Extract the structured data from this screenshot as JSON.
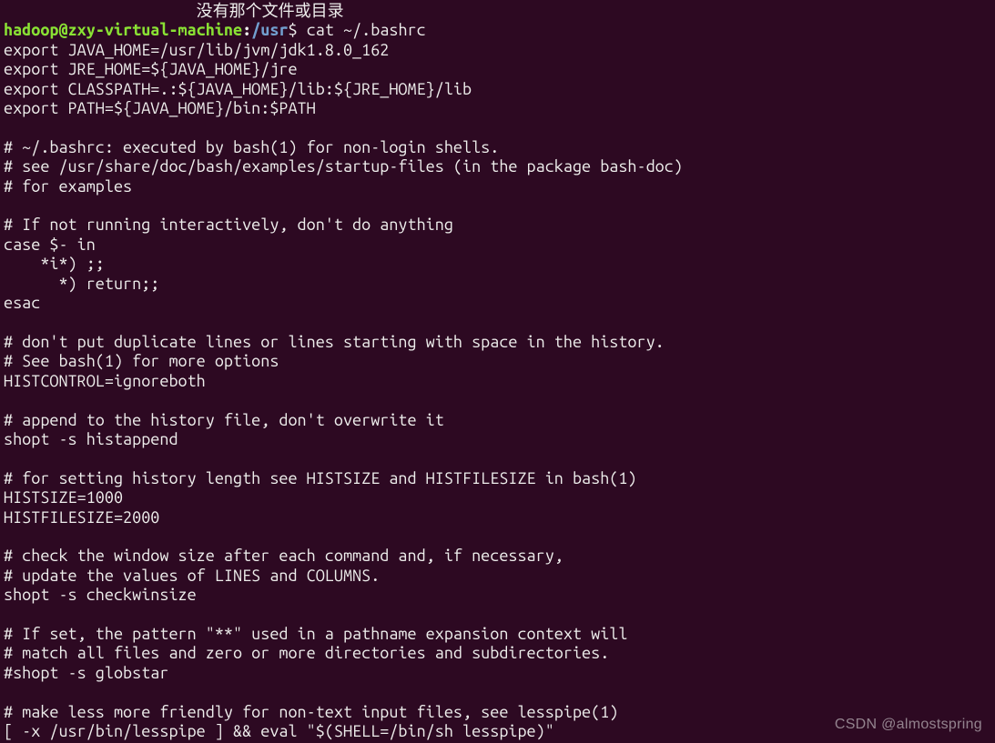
{
  "top_fragment": "                     没有那个文件或目录",
  "prompt": {
    "user": "hadoop",
    "at": "@",
    "host": "zxy-virtual-machine",
    "colon": ":",
    "path": "/usr",
    "dollar": "$ ",
    "command": "cat ~/.bashrc"
  },
  "lines": [
    "export JAVA_HOME=/usr/lib/jvm/jdk1.8.0_162",
    "export JRE_HOME=${JAVA_HOME}/jre",
    "export CLASSPATH=.:${JAVA_HOME}/lib:${JRE_HOME}/lib",
    "export PATH=${JAVA_HOME}/bin:$PATH",
    "",
    "# ~/.bashrc: executed by bash(1) for non-login shells.",
    "# see /usr/share/doc/bash/examples/startup-files (in the package bash-doc)",
    "# for examples",
    "",
    "# If not running interactively, don't do anything",
    "case $- in",
    "    *i*) ;;",
    "      *) return;;",
    "esac",
    "",
    "# don't put duplicate lines or lines starting with space in the history.",
    "# See bash(1) for more options",
    "HISTCONTROL=ignoreboth",
    "",
    "# append to the history file, don't overwrite it",
    "shopt -s histappend",
    "",
    "# for setting history length see HISTSIZE and HISTFILESIZE in bash(1)",
    "HISTSIZE=1000",
    "HISTFILESIZE=2000",
    "",
    "# check the window size after each command and, if necessary,",
    "# update the values of LINES and COLUMNS.",
    "shopt -s checkwinsize",
    "",
    "# If set, the pattern \"**\" used in a pathname expansion context will",
    "# match all files and zero or more directories and subdirectories.",
    "#shopt -s globstar",
    "",
    "# make less more friendly for non-text input files, see lesspipe(1)",
    "[ -x /usr/bin/lesspipe ] && eval \"$(SHELL=/bin/sh lesspipe)\""
  ],
  "watermark": "CSDN @almostspring"
}
